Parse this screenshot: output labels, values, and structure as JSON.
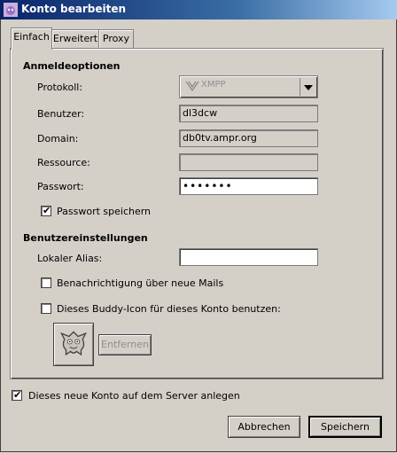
{
  "window": {
    "title": "Konto bearbeiten",
    "icon": "pidgin-icon"
  },
  "tabs": [
    {
      "label": "Einfach",
      "active": true
    },
    {
      "label": "Erweitert",
      "active": false
    },
    {
      "label": "Proxy",
      "active": false
    }
  ],
  "login": {
    "section_title": "Anmeldeoptionen",
    "protocol_label": "Protokoll:",
    "protocol_value": "XMPP",
    "username_label": "Benutzer:",
    "username_value": "dl3dcw",
    "domain_label": "Domain:",
    "domain_value": "db0tv.ampr.org",
    "resource_label": "Ressource:",
    "resource_value": "",
    "password_label": "Passwort:",
    "password_value": "•••••••",
    "remember_password_label": "Passwort speichern",
    "remember_password_checked": true
  },
  "user": {
    "section_title": "Benutzereinstellungen",
    "alias_label": "Lokaler Alias:",
    "alias_value": "",
    "new_mail_label": "Benachrichtigung über neue Mails",
    "new_mail_checked": false,
    "buddy_icon_label": "Dieses Buddy-Icon für dieses Konto benutzen:",
    "buddy_icon_checked": false,
    "remove_button": "Entfernen"
  },
  "footer": {
    "create_account_label": "Dieses neue Konto auf dem Server anlegen",
    "create_account_checked": true,
    "cancel_button": "Abbrechen",
    "save_button": "Speichern"
  }
}
